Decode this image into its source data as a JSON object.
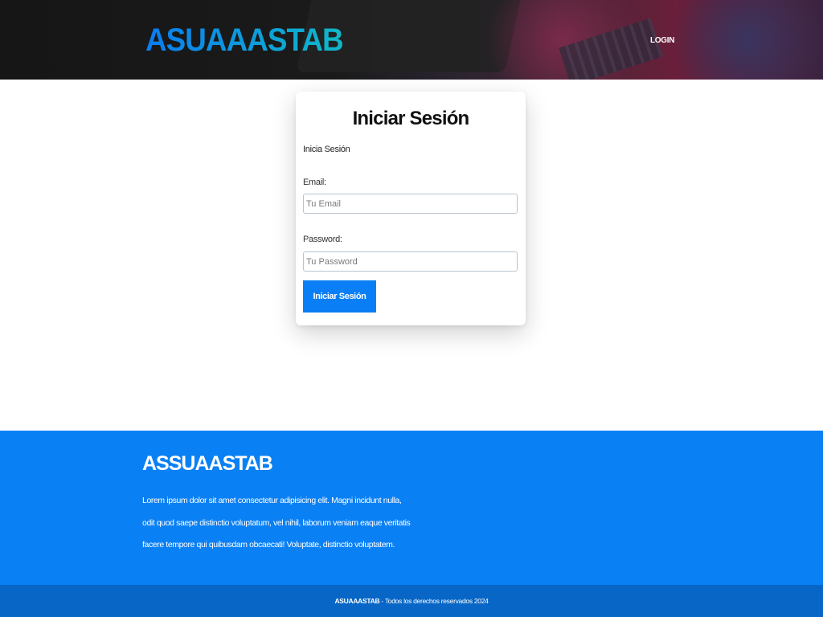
{
  "header": {
    "brand": "ASUAAASTAB",
    "nav": {
      "login_label": "LOGIN"
    }
  },
  "login_card": {
    "title": "Iniciar Sesión",
    "subtitle": "Inicia Sesión",
    "email": {
      "label": "Email:",
      "placeholder": "Tu Email",
      "value": ""
    },
    "password": {
      "label": "Password:",
      "placeholder": "Tu Password",
      "value": ""
    },
    "submit_label": "Iniciar Sesión"
  },
  "footer": {
    "brand": "ASSUAASTAB",
    "description": "Lorem ipsum dolor sit amet consectetur adipisicing elit. Magni incidunt nulla, odit quod saepe distinctio voluptatum, vel nihil, laborum veniam eaque veritatis facere tempore qui quibusdam obcaecati! Voluptate, distinctio voluptatem.",
    "copyright_brand": "ASUAAASTAB",
    "copyright_text": " - Todos los derechos reservados 2024"
  },
  "colors": {
    "primary": "#0a7ff5",
    "footer_bottom": "#0766c6",
    "header_dark": "#161616"
  }
}
